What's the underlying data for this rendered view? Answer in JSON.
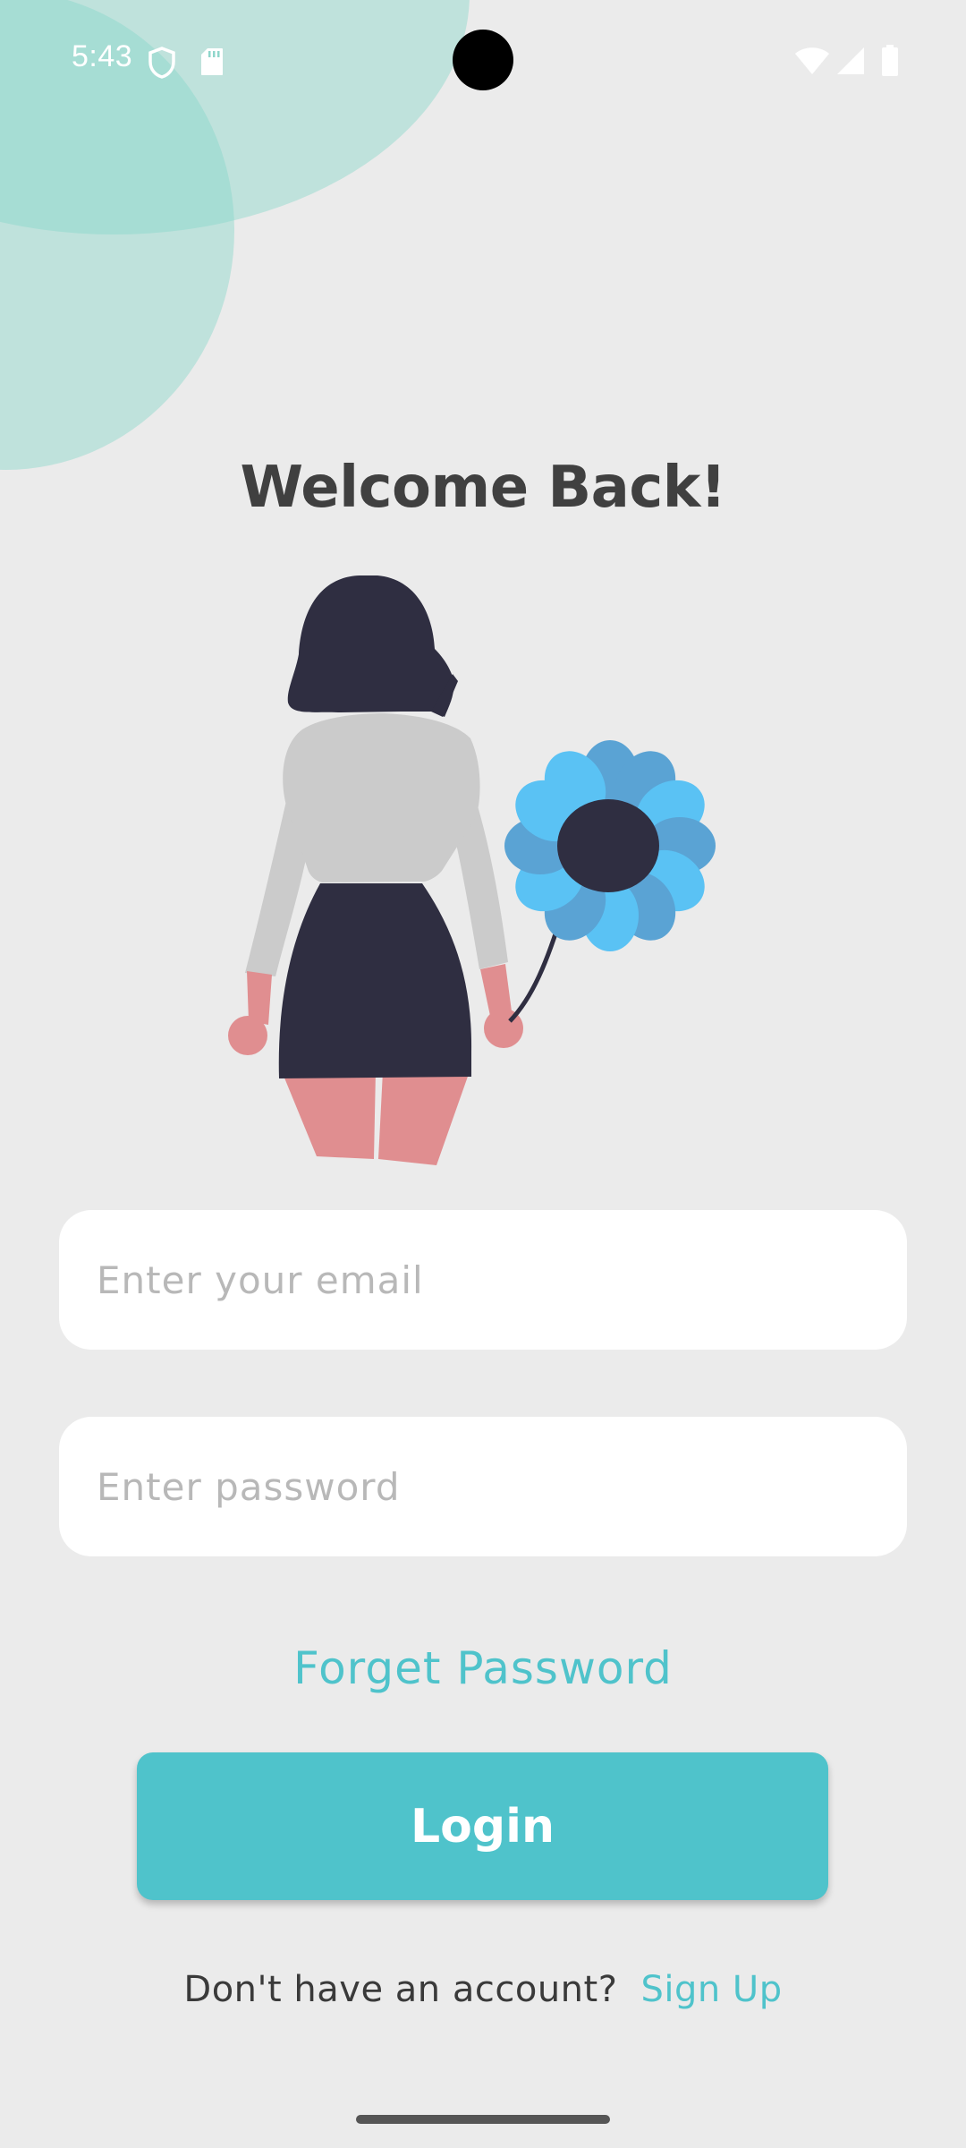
{
  "status_bar": {
    "time": "5:43",
    "icons": [
      "shield-icon",
      "sd-card-icon",
      "wifi-icon",
      "signal-icon",
      "battery-icon"
    ]
  },
  "title": "Welcome Back!",
  "illustration": {
    "icon": "woman-with-flower-illustration"
  },
  "email_field": {
    "placeholder": "Enter your email",
    "value": ""
  },
  "password_field": {
    "placeholder": "Enter password",
    "value": ""
  },
  "forget_password_label": "Forget Password",
  "login_label": "Login",
  "signup": {
    "prompt": "Don't have an account?",
    "link": "Sign Up"
  },
  "colors": {
    "accent": "#4fc3cb",
    "background": "#ebebeb",
    "decor_circle": "#82d6c8",
    "title_text": "#404040"
  }
}
